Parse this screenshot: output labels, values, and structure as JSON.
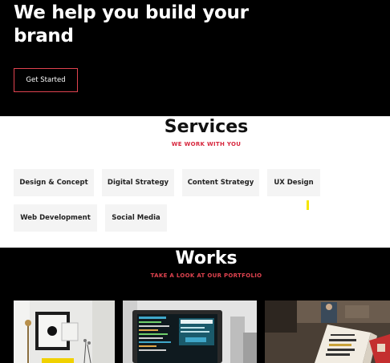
{
  "hero": {
    "title": "We help you build your brand",
    "cta_label": "Get Started"
  },
  "services": {
    "title": "Services",
    "subtitle": "WE WORK WITH YOU",
    "items": [
      {
        "label": "Design & Concept"
      },
      {
        "label": "Digital Strategy"
      },
      {
        "label": "Content Strategy"
      },
      {
        "label": "UX Design"
      },
      {
        "label": "Web Development"
      },
      {
        "label": "Social Media"
      }
    ]
  },
  "works": {
    "title": "Works",
    "subtitle": "TAKE A LOOK AT OUR PORTFOLIO",
    "thumbnails": [
      {
        "alt": "Interior with framed art"
      },
      {
        "alt": "Laptop with code"
      },
      {
        "alt": "Book on desk"
      }
    ]
  },
  "colors": {
    "accent": "#e0434f",
    "accent_text": "#d7263d",
    "chip_bg": "#f4f4f4"
  }
}
